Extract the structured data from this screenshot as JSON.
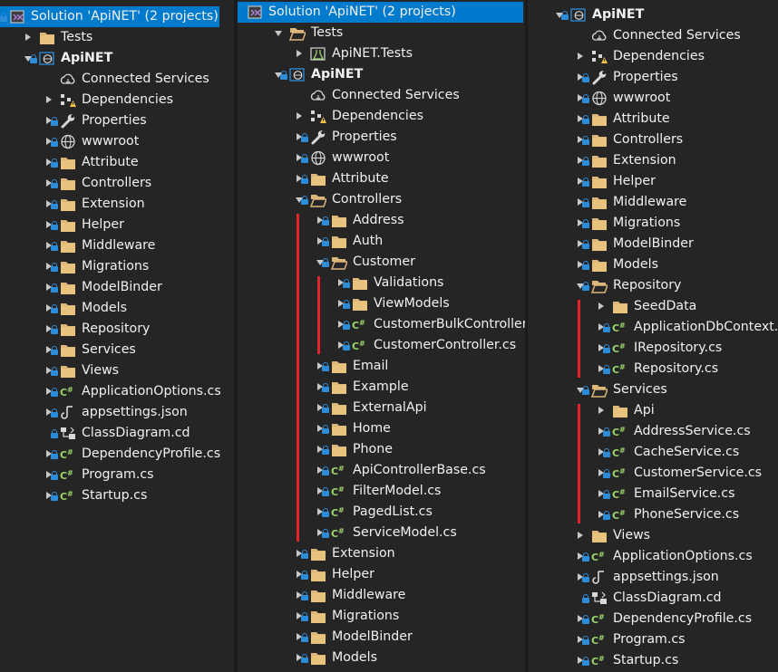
{
  "accent": "#007acc",
  "marker_color": "#e3242b",
  "panels": [
    {
      "name": "collapsed-view",
      "rows": [
        {
          "label": "Solution 'ApiNET' (2 projects)",
          "icon": "solution-icon",
          "depth": 0,
          "expander": "none",
          "lock": true,
          "selected": true
        },
        {
          "label": "Tests",
          "icon": "folder-icon",
          "depth": 1,
          "expander": "collapsed",
          "lock": false
        },
        {
          "label": "ApiNET",
          "icon": "web-project-icon",
          "depth": 1,
          "expander": "expanded",
          "lock": true,
          "bold": true
        },
        {
          "label": "Connected Services",
          "icon": "connected-services-icon",
          "depth": 2,
          "expander": "none",
          "lock": false
        },
        {
          "label": "Dependencies",
          "icon": "dependencies-icon",
          "depth": 2,
          "expander": "collapsed",
          "lock": false
        },
        {
          "label": "Properties",
          "icon": "wrench-icon",
          "depth": 2,
          "expander": "collapsed",
          "lock": true
        },
        {
          "label": "wwwroot",
          "icon": "globe-icon",
          "depth": 2,
          "expander": "collapsed",
          "lock": true
        },
        {
          "label": "Attribute",
          "icon": "folder-icon",
          "depth": 2,
          "expander": "collapsed",
          "lock": true
        },
        {
          "label": "Controllers",
          "icon": "folder-icon",
          "depth": 2,
          "expander": "collapsed",
          "lock": true
        },
        {
          "label": "Extension",
          "icon": "folder-icon",
          "depth": 2,
          "expander": "collapsed",
          "lock": true
        },
        {
          "label": "Helper",
          "icon": "folder-icon",
          "depth": 2,
          "expander": "collapsed",
          "lock": true
        },
        {
          "label": "Middleware",
          "icon": "folder-icon",
          "depth": 2,
          "expander": "collapsed",
          "lock": true
        },
        {
          "label": "Migrations",
          "icon": "folder-icon",
          "depth": 2,
          "expander": "collapsed",
          "lock": true
        },
        {
          "label": "ModelBinder",
          "icon": "folder-icon",
          "depth": 2,
          "expander": "collapsed",
          "lock": true
        },
        {
          "label": "Models",
          "icon": "folder-icon",
          "depth": 2,
          "expander": "collapsed",
          "lock": true
        },
        {
          "label": "Repository",
          "icon": "folder-icon",
          "depth": 2,
          "expander": "collapsed",
          "lock": true
        },
        {
          "label": "Services",
          "icon": "folder-icon",
          "depth": 2,
          "expander": "collapsed",
          "lock": true
        },
        {
          "label": "Views",
          "icon": "folder-icon",
          "depth": 2,
          "expander": "collapsed",
          "lock": true
        },
        {
          "label": "ApplicationOptions.cs",
          "icon": "csharp-file-icon",
          "depth": 2,
          "expander": "collapsed",
          "lock": true
        },
        {
          "label": "appsettings.json",
          "icon": "json-file-icon",
          "depth": 2,
          "expander": "collapsed",
          "lock": true
        },
        {
          "label": "ClassDiagram.cd",
          "icon": "class-diagram-icon",
          "depth": 2,
          "expander": "none",
          "lock": true
        },
        {
          "label": "DependencyProfile.cs",
          "icon": "csharp-file-icon",
          "depth": 2,
          "expander": "collapsed",
          "lock": true
        },
        {
          "label": "Program.cs",
          "icon": "csharp-file-icon",
          "depth": 2,
          "expander": "collapsed",
          "lock": true
        },
        {
          "label": "Startup.cs",
          "icon": "csharp-file-icon",
          "depth": 2,
          "expander": "collapsed",
          "lock": true
        }
      ]
    },
    {
      "name": "controllers-expanded-view",
      "rows": [
        {
          "label": "Solution 'ApiNET' (2 projects)",
          "icon": "solution-icon",
          "depth": 0,
          "expander": "none",
          "lock": false,
          "selected": true
        },
        {
          "label": "Tests",
          "icon": "folder-open-icon",
          "depth": 1,
          "expander": "expanded",
          "lock": false
        },
        {
          "label": "ApiNET.Tests",
          "icon": "test-project-icon",
          "depth": 2,
          "expander": "collapsed",
          "lock": false
        },
        {
          "label": "ApiNET",
          "icon": "web-project-icon",
          "depth": 1,
          "expander": "expanded",
          "lock": true,
          "bold": true
        },
        {
          "label": "Connected Services",
          "icon": "connected-services-icon",
          "depth": 2,
          "expander": "none",
          "lock": false
        },
        {
          "label": "Dependencies",
          "icon": "dependencies-icon",
          "depth": 2,
          "expander": "collapsed",
          "lock": false
        },
        {
          "label": "Properties",
          "icon": "wrench-icon",
          "depth": 2,
          "expander": "collapsed",
          "lock": true
        },
        {
          "label": "wwwroot",
          "icon": "globe-icon",
          "depth": 2,
          "expander": "collapsed",
          "lock": true
        },
        {
          "label": "Attribute",
          "icon": "folder-icon",
          "depth": 2,
          "expander": "collapsed",
          "lock": true
        },
        {
          "label": "Controllers",
          "icon": "folder-open-icon",
          "depth": 2,
          "expander": "expanded",
          "lock": true
        },
        {
          "label": "Address",
          "icon": "folder-icon",
          "depth": 3,
          "expander": "collapsed",
          "lock": true
        },
        {
          "label": "Auth",
          "icon": "folder-icon",
          "depth": 3,
          "expander": "collapsed",
          "lock": true
        },
        {
          "label": "Customer",
          "icon": "folder-open-icon",
          "depth": 3,
          "expander": "expanded",
          "lock": true
        },
        {
          "label": "Validations",
          "icon": "folder-icon",
          "depth": 4,
          "expander": "collapsed",
          "lock": true
        },
        {
          "label": "ViewModels",
          "icon": "folder-icon",
          "depth": 4,
          "expander": "collapsed",
          "lock": true
        },
        {
          "label": "CustomerBulkController.cs",
          "icon": "csharp-file-icon",
          "depth": 4,
          "expander": "collapsed",
          "lock": true
        },
        {
          "label": "CustomerController.cs",
          "icon": "csharp-file-icon",
          "depth": 4,
          "expander": "collapsed",
          "lock": true
        },
        {
          "label": "Email",
          "icon": "folder-icon",
          "depth": 3,
          "expander": "collapsed",
          "lock": true
        },
        {
          "label": "Example",
          "icon": "folder-icon",
          "depth": 3,
          "expander": "collapsed",
          "lock": true
        },
        {
          "label": "ExternalApi",
          "icon": "folder-icon",
          "depth": 3,
          "expander": "collapsed",
          "lock": true
        },
        {
          "label": "Home",
          "icon": "folder-icon",
          "depth": 3,
          "expander": "collapsed",
          "lock": true
        },
        {
          "label": "Phone",
          "icon": "folder-icon",
          "depth": 3,
          "expander": "collapsed",
          "lock": true
        },
        {
          "label": "ApiControllerBase.cs",
          "icon": "csharp-file-icon",
          "depth": 3,
          "expander": "collapsed",
          "lock": true
        },
        {
          "label": "FilterModel.cs",
          "icon": "csharp-file-icon",
          "depth": 3,
          "expander": "collapsed",
          "lock": true
        },
        {
          "label": "PagedList.cs",
          "icon": "csharp-file-icon",
          "depth": 3,
          "expander": "collapsed",
          "lock": true
        },
        {
          "label": "ServiceModel.cs",
          "icon": "csharp-file-icon",
          "depth": 3,
          "expander": "collapsed",
          "lock": true
        },
        {
          "label": "Extension",
          "icon": "folder-icon",
          "depth": 2,
          "expander": "collapsed",
          "lock": true
        },
        {
          "label": "Helper",
          "icon": "folder-icon",
          "depth": 2,
          "expander": "collapsed",
          "lock": true
        },
        {
          "label": "Middleware",
          "icon": "folder-icon",
          "depth": 2,
          "expander": "collapsed",
          "lock": true
        },
        {
          "label": "Migrations",
          "icon": "folder-icon",
          "depth": 2,
          "expander": "collapsed",
          "lock": true
        },
        {
          "label": "ModelBinder",
          "icon": "folder-icon",
          "depth": 2,
          "expander": "collapsed",
          "lock": true
        },
        {
          "label": "Models",
          "icon": "folder-icon",
          "depth": 2,
          "expander": "collapsed",
          "lock": true
        }
      ]
    },
    {
      "name": "repository-services-view",
      "rows": [
        {
          "label": "ApiNET",
          "icon": "web-project-icon",
          "depth": 1,
          "expander": "expanded",
          "lock": true,
          "bold": true
        },
        {
          "label": "Connected Services",
          "icon": "connected-services-icon",
          "depth": 2,
          "expander": "none",
          "lock": false
        },
        {
          "label": "Dependencies",
          "icon": "dependencies-icon",
          "depth": 2,
          "expander": "collapsed",
          "lock": false
        },
        {
          "label": "Properties",
          "icon": "wrench-icon",
          "depth": 2,
          "expander": "collapsed",
          "lock": true
        },
        {
          "label": "wwwroot",
          "icon": "globe-icon",
          "depth": 2,
          "expander": "collapsed",
          "lock": true
        },
        {
          "label": "Attribute",
          "icon": "folder-icon",
          "depth": 2,
          "expander": "collapsed",
          "lock": true
        },
        {
          "label": "Controllers",
          "icon": "folder-icon",
          "depth": 2,
          "expander": "collapsed",
          "lock": true
        },
        {
          "label": "Extension",
          "icon": "folder-icon",
          "depth": 2,
          "expander": "collapsed",
          "lock": true
        },
        {
          "label": "Helper",
          "icon": "folder-icon",
          "depth": 2,
          "expander": "collapsed",
          "lock": true
        },
        {
          "label": "Middleware",
          "icon": "folder-icon",
          "depth": 2,
          "expander": "collapsed",
          "lock": true
        },
        {
          "label": "Migrations",
          "icon": "folder-icon",
          "depth": 2,
          "expander": "collapsed",
          "lock": true
        },
        {
          "label": "ModelBinder",
          "icon": "folder-icon",
          "depth": 2,
          "expander": "collapsed",
          "lock": true
        },
        {
          "label": "Models",
          "icon": "folder-icon",
          "depth": 2,
          "expander": "collapsed",
          "lock": true
        },
        {
          "label": "Repository",
          "icon": "folder-open-icon",
          "depth": 2,
          "expander": "expanded",
          "lock": true
        },
        {
          "label": "SeedData",
          "icon": "folder-icon",
          "depth": 3,
          "expander": "collapsed",
          "lock": false
        },
        {
          "label": "ApplicationDbContext.cs",
          "icon": "csharp-file-icon",
          "depth": 3,
          "expander": "collapsed",
          "lock": true
        },
        {
          "label": "IRepository.cs",
          "icon": "csharp-file-icon",
          "depth": 3,
          "expander": "collapsed",
          "lock": true
        },
        {
          "label": "Repository.cs",
          "icon": "csharp-file-icon",
          "depth": 3,
          "expander": "collapsed",
          "lock": true
        },
        {
          "label": "Services",
          "icon": "folder-open-icon",
          "depth": 2,
          "expander": "expanded",
          "lock": true
        },
        {
          "label": "Api",
          "icon": "folder-icon",
          "depth": 3,
          "expander": "collapsed",
          "lock": false
        },
        {
          "label": "AddressService.cs",
          "icon": "csharp-file-icon",
          "depth": 3,
          "expander": "collapsed",
          "lock": true
        },
        {
          "label": "CacheService.cs",
          "icon": "csharp-file-icon",
          "depth": 3,
          "expander": "collapsed",
          "lock": true
        },
        {
          "label": "CustomerService.cs",
          "icon": "csharp-file-icon",
          "depth": 3,
          "expander": "collapsed",
          "lock": true
        },
        {
          "label": "EmailService.cs",
          "icon": "csharp-file-icon",
          "depth": 3,
          "expander": "collapsed",
          "lock": true
        },
        {
          "label": "PhoneService.cs",
          "icon": "csharp-file-icon",
          "depth": 3,
          "expander": "collapsed",
          "lock": true
        },
        {
          "label": "Views",
          "icon": "folder-icon",
          "depth": 2,
          "expander": "collapsed",
          "lock": false
        },
        {
          "label": "ApplicationOptions.cs",
          "icon": "csharp-file-icon",
          "depth": 2,
          "expander": "collapsed",
          "lock": true
        },
        {
          "label": "appsettings.json",
          "icon": "json-file-icon",
          "depth": 2,
          "expander": "collapsed",
          "lock": true
        },
        {
          "label": "ClassDiagram.cd",
          "icon": "class-diagram-icon",
          "depth": 2,
          "expander": "none",
          "lock": true
        },
        {
          "label": "DependencyProfile.cs",
          "icon": "csharp-file-icon",
          "depth": 2,
          "expander": "collapsed",
          "lock": true
        },
        {
          "label": "Program.cs",
          "icon": "csharp-file-icon",
          "depth": 2,
          "expander": "collapsed",
          "lock": true
        },
        {
          "label": "Startup.cs",
          "icon": "csharp-file-icon",
          "depth": 2,
          "expander": "collapsed",
          "lock": true
        }
      ]
    }
  ]
}
